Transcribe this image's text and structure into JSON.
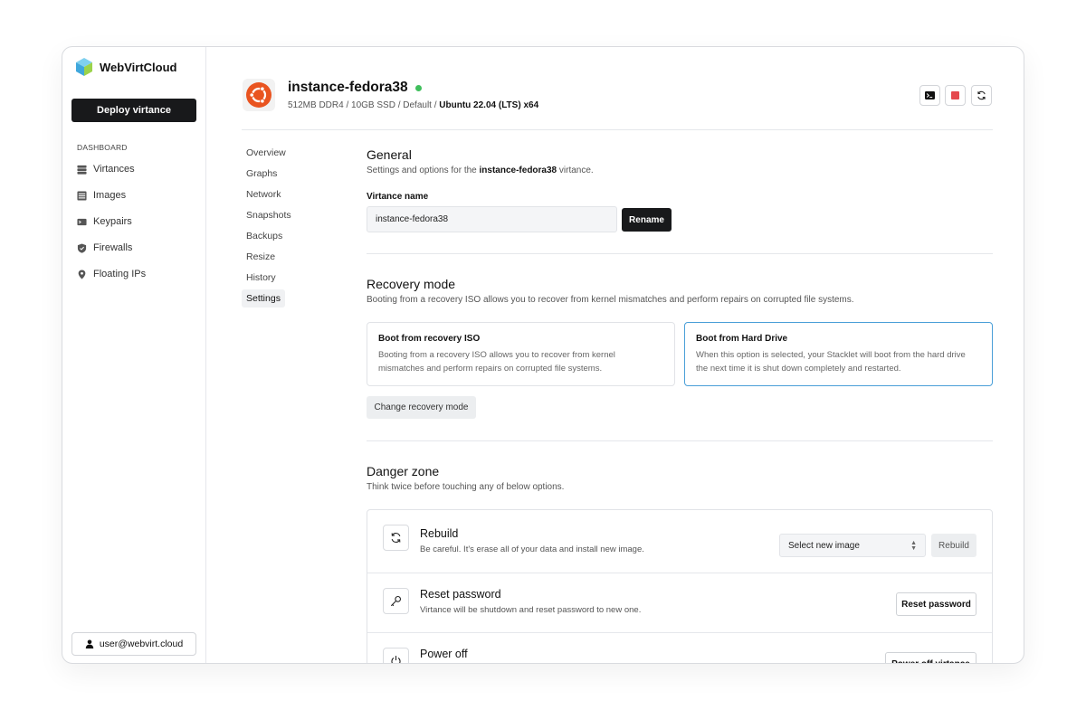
{
  "app": {
    "name": "WebVirtCloud"
  },
  "sidebar": {
    "deploy_label": "Deploy virtance",
    "heading": "DASHBOARD",
    "items": [
      {
        "label": "Virtances",
        "icon": "server-icon"
      },
      {
        "label": "Images",
        "icon": "images-icon"
      },
      {
        "label": "Keypairs",
        "icon": "keypair-icon"
      },
      {
        "label": "Firewalls",
        "icon": "shield-icon"
      },
      {
        "label": "Floating IPs",
        "icon": "location-pin-icon"
      }
    ],
    "user": "user@webvirt.cloud"
  },
  "instance": {
    "name": "instance-fedora38",
    "status": "running",
    "status_color": "#3fbf5c",
    "meta": "512MB DDR4 / 10GB SSD / Default / ",
    "os": "Ubuntu 22.04 (LTS) x64",
    "os_icon": "ubuntu-icon"
  },
  "header_actions": [
    {
      "name": "console",
      "icon": "terminal-icon"
    },
    {
      "name": "stop",
      "icon": "stop-icon",
      "color": "#e5484d"
    },
    {
      "name": "restart",
      "icon": "refresh-icon"
    }
  ],
  "subnav": {
    "items": [
      "Overview",
      "Graphs",
      "Network",
      "Snapshots",
      "Backups",
      "Resize",
      "History",
      "Settings"
    ],
    "active": "Settings"
  },
  "general": {
    "title": "General",
    "desc_prefix": "Settings and options for the ",
    "desc_name": "instance-fedora38",
    "desc_suffix": " virtance.",
    "field_label": "Virtance name",
    "field_value": "instance-fedora38",
    "rename_label": "Rename"
  },
  "recovery": {
    "title": "Recovery mode",
    "desc": "Booting from a recovery ISO allows you to recover from kernel mismatches and perform repairs on corrupted file systems.",
    "options": [
      {
        "title": "Boot from recovery ISO",
        "line1": "Booting from a recovery ISO allows you to recover from kernel",
        "line2": "mismatches and perform repairs on corrupted file systems.",
        "selected": false
      },
      {
        "title": "Boot from Hard Drive",
        "line1": "When this option is selected, your Stacklet will boot from the hard drive",
        "line2": "the next time it is shut down completely and restarted.",
        "selected": true
      }
    ],
    "change_label": "Change recovery mode",
    "selected_border": "#4a9fd8"
  },
  "danger": {
    "title": "Danger zone",
    "desc": "Think twice before touching any of below options.",
    "rebuild": {
      "title": "Rebuild",
      "desc": "Be careful. It's erase all of your data and install new image.",
      "select_value": "Select new image",
      "button": "Rebuild"
    },
    "reset": {
      "title": "Reset password",
      "desc": "Virtance will be shutdown and reset password to new one.",
      "button": "Reset password"
    },
    "power": {
      "title": "Power off",
      "button": "Power off virtance"
    }
  }
}
